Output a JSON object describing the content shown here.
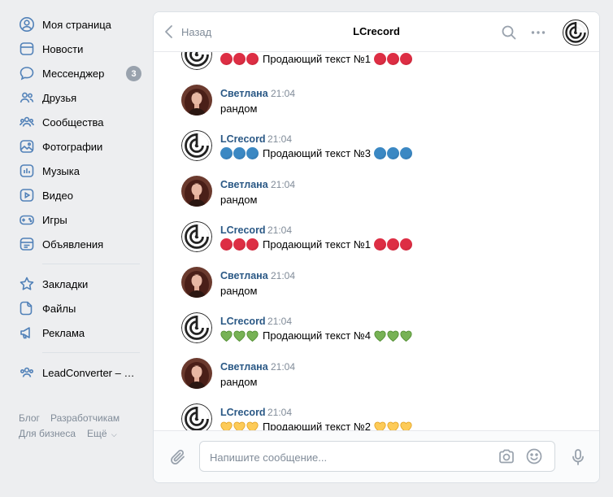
{
  "sidebar": {
    "items": [
      {
        "label": "Моя страница",
        "icon": "user-circle-icon"
      },
      {
        "label": "Новости",
        "icon": "news-icon"
      },
      {
        "label": "Мессенджер",
        "icon": "message-icon",
        "badge": "3"
      },
      {
        "label": "Друзья",
        "icon": "friends-icon"
      },
      {
        "label": "Сообщества",
        "icon": "communities-icon"
      },
      {
        "label": "Фотографии",
        "icon": "photo-icon"
      },
      {
        "label": "Музыка",
        "icon": "music-icon"
      },
      {
        "label": "Видео",
        "icon": "video-icon"
      },
      {
        "label": "Игры",
        "icon": "gamepad-icon"
      },
      {
        "label": "Объявления",
        "icon": "classifieds-icon"
      },
      {
        "label": "Закладки",
        "icon": "star-icon"
      },
      {
        "label": "Файлы",
        "icon": "file-icon"
      },
      {
        "label": "Реклама",
        "icon": "megaphone-icon"
      },
      {
        "label": "LeadConverter – Ко...",
        "icon": "community-app-icon"
      }
    ],
    "footer": {
      "blog": "Блог",
      "developers": "Разработчикам",
      "business": "Для бизнеса",
      "more": "Ещё"
    }
  },
  "chat": {
    "back_label": "Назад",
    "title": "LCrecord",
    "messages": [
      {
        "author": "",
        "time": "",
        "text": "Продающий текст №1",
        "deco": "red"
      },
      {
        "author": "Светлана",
        "time": "21:04",
        "text": "рандом",
        "deco": ""
      },
      {
        "author": "LCrecord",
        "time": "21:04",
        "text": "Продающий текст №3",
        "deco": "blue"
      },
      {
        "author": "Светлана",
        "time": "21:04",
        "text": "рандом",
        "deco": ""
      },
      {
        "author": "LCrecord",
        "time": "21:04",
        "text": "Продающий текст №1",
        "deco": "red"
      },
      {
        "author": "Светлана",
        "time": "21:04",
        "text": "рандом",
        "deco": ""
      },
      {
        "author": "LCrecord",
        "time": "21:04",
        "text": "Продающий текст №4",
        "deco": "green"
      },
      {
        "author": "Светлана",
        "time": "21:04",
        "text": "рандом",
        "deco": ""
      },
      {
        "author": "LCrecord",
        "time": "21:04",
        "text": "Продающий текст №2",
        "deco": "yellow"
      }
    ],
    "composer": {
      "placeholder": "Напишите сообщение..."
    }
  },
  "colors": {
    "accent": "#2a5885",
    "red": "#dd2e44",
    "blue": "#3b88c3",
    "green": "#77b255",
    "yellow": "#fdcb58"
  }
}
